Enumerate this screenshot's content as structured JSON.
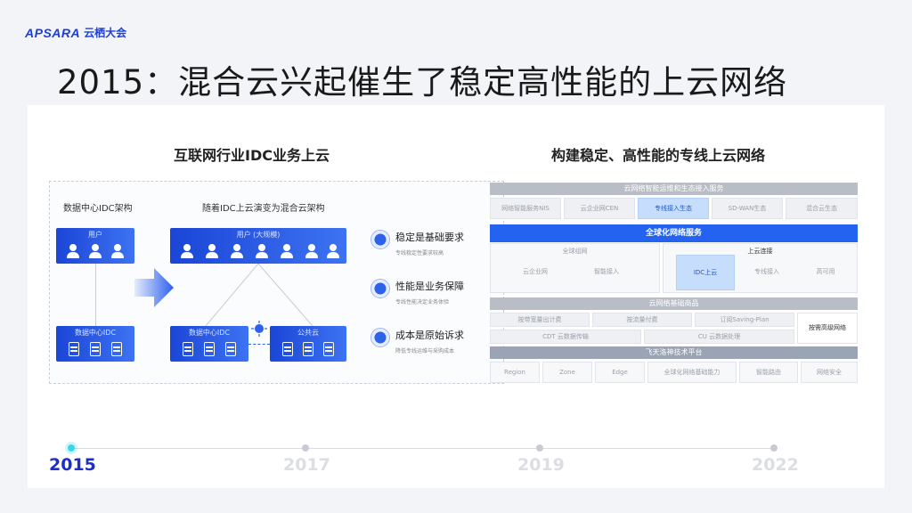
{
  "brand": {
    "logo_text": "APSARA",
    "logo_cn": "云栖大会"
  },
  "title": "2015：混合云兴起催生了稳定高性能的上云网络",
  "left": {
    "heading": "互联网行业IDC业务上云",
    "label_arch": "数据中心IDC架构",
    "label_evolve": "随着IDC上云演变为混合云架构",
    "box_users": "用户",
    "box_users2": "用户 (大规模)",
    "box_idc": "数据中心IDC",
    "box_idc2": "数据中心IDC",
    "box_cloud": "公共云",
    "features": [
      {
        "title": "稳定是基础要求",
        "sub": "专线稳定性要求较高"
      },
      {
        "title": "性能是业务保障",
        "sub": "专线性能决定业务体验"
      },
      {
        "title": "成本是原始诉求",
        "sub": "降低专线运维与采购成本"
      }
    ]
  },
  "right": {
    "heading": "构建稳定、高性能的专线上云网络",
    "bar_top": "云网络智能运维和生态接入服务",
    "top_cells": [
      "网络智能服务NIS",
      "云企业网CEN",
      "专线接入生态",
      "SD-WAN生态",
      "混合云生态"
    ],
    "bar_full": "全球化网络服务",
    "mid_group1": "全球组网",
    "mid_group2": "上云连接",
    "mid_cells": [
      "云企业网",
      "智能接入",
      "专线接入",
      "IDC上云",
      "高可用"
    ],
    "bar_base": "云网络基础商品",
    "base_cells": [
      "按带宽量出计费",
      "按流量付费",
      "订阅Saving-Plan",
      "CDT 云数据传输",
      "CU 云数据处理"
    ],
    "base_side": "按需高级网络",
    "bar_platform": "飞天洛神技术平台",
    "platform_cells": [
      "Region",
      "Zone",
      "Edge",
      "全球化网络基础能力",
      "智能路由",
      "网络安全"
    ]
  },
  "timeline": {
    "years": [
      "2015",
      "2017",
      "2019",
      "2022"
    ],
    "active": "2015"
  },
  "colors": {
    "accent": "#1d2fc9",
    "blue": "#2463ef",
    "cyan": "#3cd6e6"
  }
}
